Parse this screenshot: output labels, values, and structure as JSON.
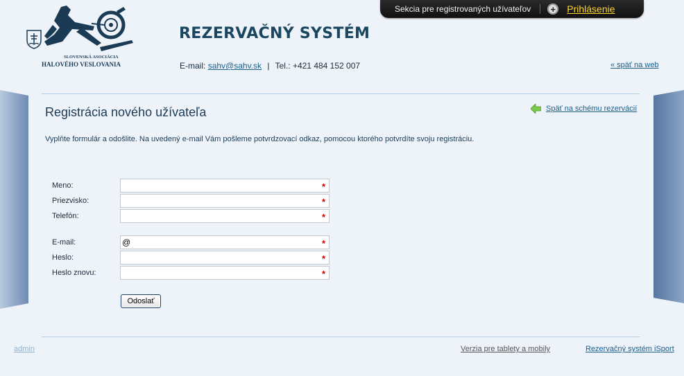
{
  "topbar": {
    "section_label": "Sekcia pre registrovaných užívateľov",
    "login_label": "Prihlásenie"
  },
  "logo": {
    "line1": "SLOVENSKÁ ASOCIÁCIA",
    "line2": "HALOVÉHO VESLOVANIA"
  },
  "header": {
    "system_title": "REZERVAČNÝ SYSTÉM",
    "email_label": "E-mail:",
    "email": "sahv@sahv.sk",
    "separator": "|",
    "phone": "Tel.: +421 484 152 007",
    "back_to_web": "« späť na web"
  },
  "main": {
    "title": "Registrácia nového užívateľa",
    "back_to_schema": "Späť na schému rezervácií",
    "intro": "Vyplňte formulár a odošlite. Na uvedený e-mail Vám pošleme potvrdzovací odkaz, pomocou ktorého potvrdíte svoju registráciu."
  },
  "form": {
    "first_name": {
      "label": "Meno:",
      "value": ""
    },
    "last_name": {
      "label": "Priezvisko:",
      "value": ""
    },
    "phone": {
      "label": "Telefón:",
      "value": ""
    },
    "email": {
      "label": "E-mail:",
      "value": "@"
    },
    "password": {
      "label": "Heslo:",
      "value": ""
    },
    "password_again": {
      "label": "Heslo znovu:",
      "value": ""
    },
    "required_mark": "*",
    "submit_label": "Odoslať"
  },
  "footer": {
    "admin": "admin",
    "mobile_version": "Verzia pre tablety a mobily",
    "isport": "Rezervačný systém iSport"
  },
  "colors": {
    "background": "#eef3fa",
    "accent": "#1a5e8a",
    "login": "#ffd62a",
    "required": "#d40000"
  }
}
